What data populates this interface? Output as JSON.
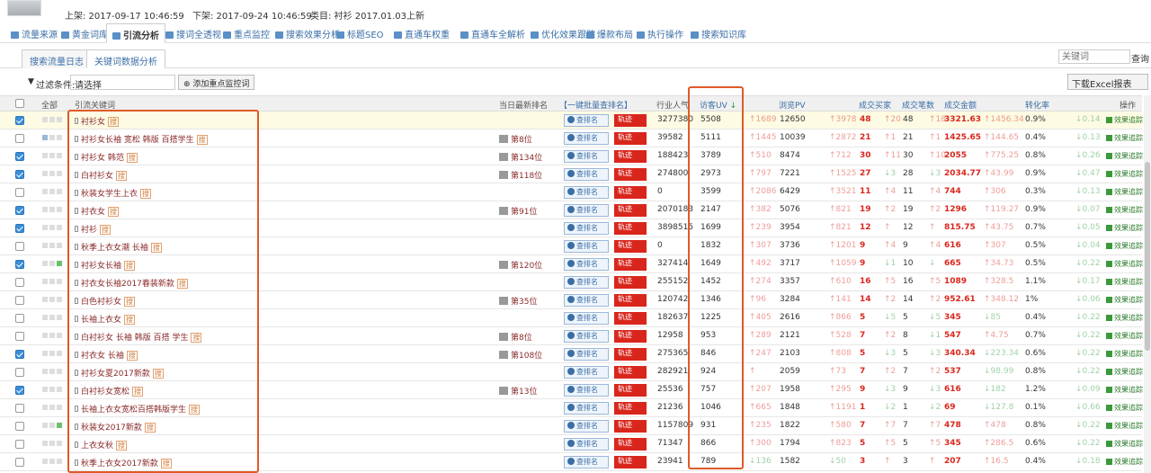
{
  "header": {
    "listed": "上架: 2017-09-17 10:46:59",
    "delisted": "下架: 2017-09-24 10:46:59",
    "category": "类目: 衬衫 2017.01.03上新"
  },
  "nav": [
    {
      "label": "流量来源",
      "icon": "traffic-icon"
    },
    {
      "label": "黄金词库",
      "icon": "gold-icon"
    },
    {
      "label": "引流分析",
      "icon": "download-icon",
      "active": true
    },
    {
      "label": "搜词全透视",
      "icon": "search-icon"
    },
    {
      "label": "重点监控",
      "icon": "monitor-icon"
    },
    {
      "label": "搜索效果分析",
      "icon": "chart-icon"
    },
    {
      "label": "标题SEO",
      "icon": "seo-icon"
    },
    {
      "label": "直通车权重",
      "icon": "car-icon"
    },
    {
      "label": "直通车全解析",
      "icon": "car-icon"
    },
    {
      "label": "优化效果跟踪",
      "icon": "track-icon"
    },
    {
      "label": "爆款布局",
      "icon": "calendar-icon"
    },
    {
      "label": "执行操作",
      "icon": "monitor-icon"
    },
    {
      "label": "搜索知识库",
      "icon": "book-icon"
    }
  ],
  "subtabs": [
    "搜索流量日志",
    "关键词数据分析"
  ],
  "search": {
    "placeholder": "关键词",
    "query_label": "查询"
  },
  "filter": {
    "label": "过滤条件:",
    "select_value": "请选择",
    "add_button": "添加重点监控词"
  },
  "export_label": "下载Excel报表",
  "columns": {
    "all": "全部",
    "keyword": "引流关键词",
    "rank": "当日最新排名",
    "batch": "【一键批量查排名】",
    "industry": "行业人气",
    "uv": "访客UV",
    "pv": "浏览PV",
    "buyers": "成交买家",
    "orders": "成交笔数",
    "amount": "成交金额",
    "conv": "转化率",
    "ops": "操作"
  },
  "check_label": "查排名",
  "track_label": "轨迹",
  "effect_label": "效果追踪",
  "rows": [
    {
      "checked": true,
      "kw": "衬衫女",
      "tag": "搜",
      "rank": "",
      "ind": "3277380",
      "uv": "5508",
      "uvd": "1689",
      "uvu": true,
      "pv": "12650",
      "pvd": "3978",
      "pvu": true,
      "b": "48",
      "bd": "20",
      "bu": true,
      "o": "48",
      "od": "18",
      "ou": true,
      "amt": "3321.63",
      "ad": "1456.34",
      "au": true,
      "cv": "0.9%",
      "cd": "0.14",
      "cu": false
    },
    {
      "checked": false,
      "kw": "衬衫女长袖 宽松 韩版 百搭学生",
      "tag": "搜",
      "rank": "第8位",
      "ind": "39582",
      "uv": "5111",
      "uvd": "1445",
      "uvu": true,
      "pv": "10039",
      "pvd": "2872",
      "pvu": true,
      "b": "21",
      "bd": "1",
      "bu": true,
      "o": "21",
      "od": "1",
      "ou": true,
      "amt": "1425.65",
      "ad": "144.65",
      "au": true,
      "cv": "0.4%",
      "cd": "0.13",
      "cu": false
    },
    {
      "checked": true,
      "kw": "衬衫女 韩范",
      "tag": "搜",
      "rank": "第134位",
      "ind": "188423",
      "uv": "3789",
      "uvd": "510",
      "uvu": true,
      "pv": "8474",
      "pvd": "712",
      "pvu": true,
      "b": "30",
      "bd": "11",
      "bu": true,
      "o": "30",
      "od": "10",
      "ou": true,
      "amt": "2055",
      "ad": "775.25",
      "au": true,
      "cv": "0.8%",
      "cd": "0.26",
      "cu": false
    },
    {
      "checked": true,
      "kw": "白衬衫女",
      "tag": "搜",
      "rank": "第118位",
      "ind": "274800",
      "uv": "2973",
      "uvd": "797",
      "uvu": true,
      "pv": "7221",
      "pvd": "1525",
      "pvu": true,
      "b": "27",
      "bd": "3",
      "bu": false,
      "o": "28",
      "od": "3",
      "ou": false,
      "amt": "2034.77",
      "ad": "43.99",
      "au": true,
      "cv": "0.9%",
      "cd": "0.47",
      "cu": false
    },
    {
      "checked": false,
      "kw": "秋装女学生上衣",
      "tag": "搜",
      "rank": "",
      "ind": "0",
      "uv": "3599",
      "uvd": "2086",
      "uvu": true,
      "pv": "6429",
      "pvd": "3521",
      "pvu": true,
      "b": "11",
      "bd": "4",
      "bu": true,
      "o": "11",
      "od": "4",
      "ou": true,
      "amt": "744",
      "ad": "306",
      "au": true,
      "cv": "0.3%",
      "cd": "0.13",
      "cu": false
    },
    {
      "checked": true,
      "kw": "衬衣女",
      "tag": "搜",
      "rank": "第91位",
      "ind": "2070183",
      "uv": "2147",
      "uvd": "382",
      "uvu": true,
      "pv": "5076",
      "pvd": "821",
      "pvu": true,
      "b": "19",
      "bd": "2",
      "bu": true,
      "o": "19",
      "od": "2",
      "ou": true,
      "amt": "1296",
      "ad": "119.27",
      "au": true,
      "cv": "0.9%",
      "cd": "0.07",
      "cu": false
    },
    {
      "checked": true,
      "kw": "衬衫",
      "tag": "搜",
      "rank": "",
      "ind": "3898515",
      "uv": "1699",
      "uvd": "239",
      "uvu": true,
      "pv": "3954",
      "pvd": "821",
      "pvu": true,
      "b": "12",
      "bd": "",
      "bu": true,
      "o": "12",
      "od": "",
      "ou": true,
      "amt": "815.75",
      "ad": "43.75",
      "au": true,
      "cv": "0.7%",
      "cd": "0.05",
      "cu": false
    },
    {
      "checked": false,
      "kw": "秋季上衣女潮 长袖",
      "tag": "搜",
      "rank": "",
      "ind": "0",
      "uv": "1832",
      "uvd": "307",
      "uvu": true,
      "pv": "3736",
      "pvd": "1201",
      "pvu": true,
      "b": "9",
      "bd": "4",
      "bu": true,
      "o": "9",
      "od": "4",
      "ou": true,
      "amt": "616",
      "ad": "307",
      "au": true,
      "cv": "0.5%",
      "cd": "0.04",
      "cu": false
    },
    {
      "checked": true,
      "kw": "衬衫女长袖",
      "tag": "搜",
      "rank": "第120位",
      "ind": "327414",
      "uv": "1649",
      "uvd": "492",
      "uvu": true,
      "pv": "3717",
      "pvd": "1059",
      "pvu": true,
      "b": "9",
      "bd": "1",
      "bu": false,
      "o": "10",
      "od": "",
      "ou": false,
      "amt": "665",
      "ad": "34.73",
      "au": true,
      "cv": "0.5%",
      "cd": "0.22",
      "cu": false
    },
    {
      "checked": false,
      "kw": "衬衣女长袖2017春装新款",
      "tag": "搜",
      "rank": "",
      "ind": "255152",
      "uv": "1452",
      "uvd": "274",
      "uvu": true,
      "pv": "3357",
      "pvd": "610",
      "pvu": true,
      "b": "16",
      "bd": "5",
      "bu": true,
      "o": "16",
      "od": "5",
      "ou": true,
      "amt": "1089",
      "ad": "328.5",
      "au": true,
      "cv": "1.1%",
      "cd": "0.17",
      "cu": false
    },
    {
      "checked": false,
      "kw": "白色衬衫女",
      "tag": "搜",
      "rank": "第35位",
      "ind": "120742",
      "uv": "1346",
      "uvd": "96",
      "uvu": true,
      "pv": "3284",
      "pvd": "141",
      "pvu": true,
      "b": "14",
      "bd": "2",
      "bu": true,
      "o": "14",
      "od": "2",
      "ou": true,
      "amt": "952.61",
      "ad": "348.12",
      "au": true,
      "cv": "1%",
      "cd": "0.06",
      "cu": false
    },
    {
      "checked": false,
      "kw": "长袖上衣女",
      "tag": "搜",
      "rank": "",
      "ind": "182637",
      "uv": "1225",
      "uvd": "405",
      "uvu": true,
      "pv": "2616",
      "pvd": "866",
      "pvu": true,
      "b": "5",
      "bd": "5",
      "bu": false,
      "o": "5",
      "od": "5",
      "ou": false,
      "amt": "345",
      "ad": "85",
      "au": false,
      "cv": "0.4%",
      "cd": "0.22",
      "cu": false
    },
    {
      "checked": false,
      "kw": "白衬衫女 长袖 韩版 百搭 学生",
      "tag": "搜",
      "rank": "第8位",
      "ind": "12958",
      "uv": "953",
      "uvd": "289",
      "uvu": true,
      "pv": "2121",
      "pvd": "528",
      "pvu": true,
      "b": "7",
      "bd": "2",
      "bu": true,
      "o": "8",
      "od": "1",
      "ou": false,
      "amt": "547",
      "ad": "4.75",
      "au": true,
      "cv": "0.7%",
      "cd": "0.22",
      "cu": false
    },
    {
      "checked": true,
      "kw": "衬衣女 长袖",
      "tag": "搜",
      "rank": "第108位",
      "ind": "275365",
      "uv": "846",
      "uvd": "247",
      "uvu": true,
      "pv": "2103",
      "pvd": "808",
      "pvu": true,
      "b": "5",
      "bd": "3",
      "bu": false,
      "o": "5",
      "od": "3",
      "ou": false,
      "amt": "340.34",
      "ad": "223.34",
      "au": false,
      "cv": "0.6%",
      "cd": "0.22",
      "cu": false
    },
    {
      "checked": false,
      "kw": "衬衫女夏2017新款",
      "tag": "搜",
      "rank": "",
      "ind": "282921",
      "uv": "924",
      "uvd": "",
      "uvu": true,
      "pv": "2059",
      "pvd": "73",
      "pvu": true,
      "b": "7",
      "bd": "2",
      "bu": true,
      "o": "7",
      "od": "2",
      "ou": true,
      "amt": "537",
      "ad": "98.99",
      "au": false,
      "cv": "0.8%",
      "cd": "0.22",
      "cu": false
    },
    {
      "checked": true,
      "kw": "白衬衫女宽松",
      "tag": "搜",
      "rank": "第13位",
      "ind": "25536",
      "uv": "757",
      "uvd": "207",
      "uvu": true,
      "pv": "1958",
      "pvd": "295",
      "pvu": true,
      "b": "9",
      "bd": "3",
      "bu": false,
      "o": "9",
      "od": "3",
      "ou": false,
      "amt": "616",
      "ad": "182",
      "au": false,
      "cv": "1.2%",
      "cd": "0.09",
      "cu": false
    },
    {
      "checked": false,
      "kw": "长袖上衣女宽松百搭韩版学生",
      "tag": "搜",
      "rank": "",
      "ind": "21236",
      "uv": "1046",
      "uvd": "665",
      "uvu": true,
      "pv": "1848",
      "pvd": "1191",
      "pvu": true,
      "b": "1",
      "bd": "2",
      "bu": false,
      "o": "1",
      "od": "2",
      "ou": false,
      "amt": "69",
      "ad": "127.8",
      "au": false,
      "cv": "0.1%",
      "cd": "0.66",
      "cu": false
    },
    {
      "checked": false,
      "kw": "秋装女2017新款",
      "tag": "搜",
      "rank": "",
      "ind": "1157809",
      "uv": "931",
      "uvd": "235",
      "uvu": true,
      "pv": "1822",
      "pvd": "580",
      "pvu": true,
      "b": "7",
      "bd": "7",
      "bu": true,
      "o": "7",
      "od": "7",
      "ou": true,
      "amt": "478",
      "ad": "478",
      "au": true,
      "cv": "0.8%",
      "cd": "0.22",
      "cu": false
    },
    {
      "checked": false,
      "kw": "上衣女秋",
      "tag": "搜",
      "rank": "",
      "ind": "71347",
      "uv": "866",
      "uvd": "300",
      "uvu": true,
      "pv": "1794",
      "pvd": "823",
      "pvu": true,
      "b": "5",
      "bd": "5",
      "bu": true,
      "o": "5",
      "od": "5",
      "ou": true,
      "amt": "345",
      "ad": "286.5",
      "au": true,
      "cv": "0.6%",
      "cd": "0.22",
      "cu": false
    },
    {
      "checked": false,
      "kw": "秋季上衣女2017新款",
      "tag": "搜",
      "rank": "",
      "ind": "23941",
      "uv": "789",
      "uvd": "136",
      "uvu": false,
      "pv": "1582",
      "pvd": "50",
      "pvu": false,
      "b": "3",
      "bd": "",
      "bu": true,
      "o": "3",
      "od": "",
      "ou": true,
      "amt": "207",
      "ad": "16.5",
      "au": true,
      "cv": "0.4%",
      "cd": "0.18",
      "cu": false
    }
  ],
  "colors": {
    "up": "#d9261c",
    "down": "#2a9a3a",
    "highlight_box": "#e05a2a",
    "link": "#3a6ea5"
  }
}
